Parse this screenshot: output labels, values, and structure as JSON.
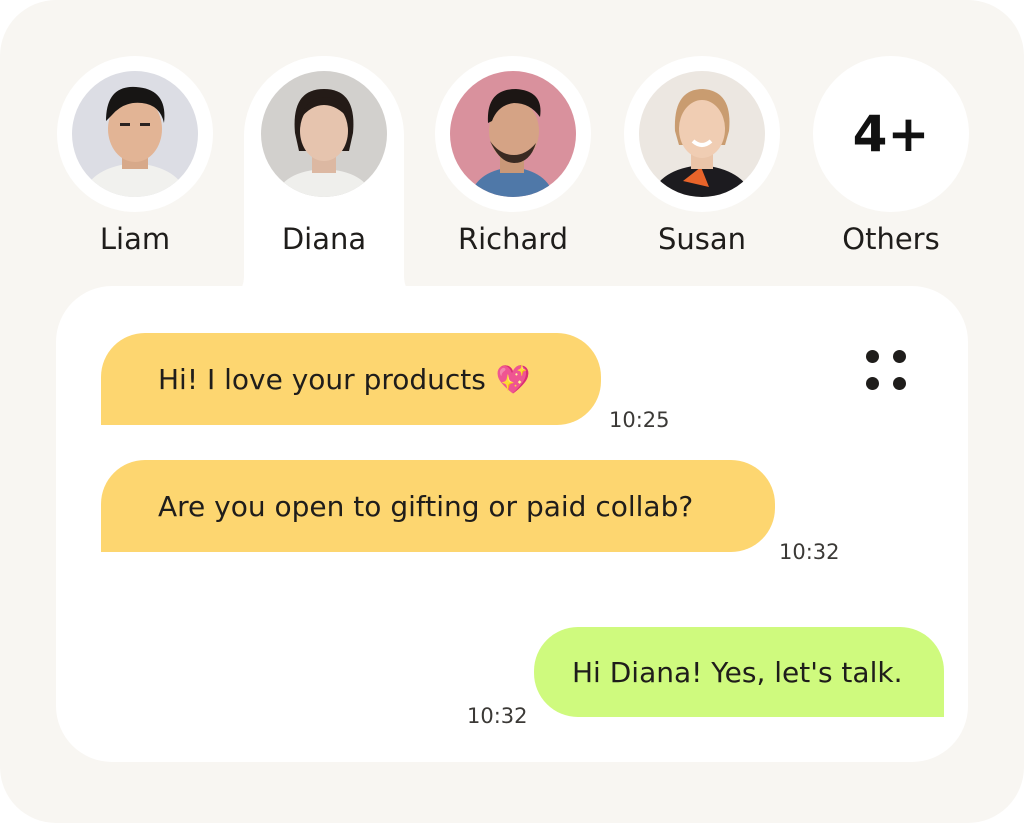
{
  "contacts": [
    {
      "name": "Liam",
      "active": false
    },
    {
      "name": "Diana",
      "active": true
    },
    {
      "name": "Richard",
      "active": false
    },
    {
      "name": "Susan",
      "active": false
    },
    {
      "name": "Others",
      "count_label": "4+",
      "active": false
    }
  ],
  "chat": {
    "messages": [
      {
        "text": "Hi! I  love your products",
        "emoji": "💖",
        "time": "10:25",
        "direction": "incoming"
      },
      {
        "text": "Are you open to gifting or paid collab?",
        "time": "10:32",
        "direction": "incoming"
      },
      {
        "text": "Hi Diana! Yes, let's talk.",
        "time": "10:32",
        "direction": "outgoing"
      }
    ]
  },
  "colors": {
    "frame_bg": "#f8f6f2",
    "incoming_bubble": "#fdd670",
    "outgoing_bubble": "#cffa7e",
    "text": "#1f1d1b"
  }
}
